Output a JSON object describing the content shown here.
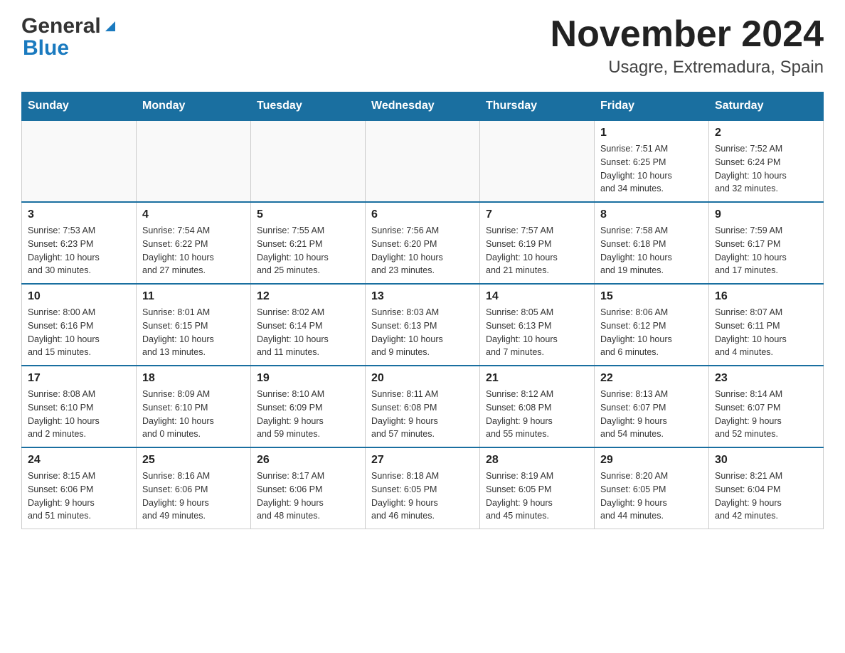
{
  "header": {
    "logo_general": "General",
    "logo_blue": "Blue",
    "title": "November 2024",
    "subtitle": "Usagre, Extremadura, Spain"
  },
  "weekdays": [
    "Sunday",
    "Monday",
    "Tuesday",
    "Wednesday",
    "Thursday",
    "Friday",
    "Saturday"
  ],
  "weeks": [
    [
      {
        "day": "",
        "info": ""
      },
      {
        "day": "",
        "info": ""
      },
      {
        "day": "",
        "info": ""
      },
      {
        "day": "",
        "info": ""
      },
      {
        "day": "",
        "info": ""
      },
      {
        "day": "1",
        "info": "Sunrise: 7:51 AM\nSunset: 6:25 PM\nDaylight: 10 hours\nand 34 minutes."
      },
      {
        "day": "2",
        "info": "Sunrise: 7:52 AM\nSunset: 6:24 PM\nDaylight: 10 hours\nand 32 minutes."
      }
    ],
    [
      {
        "day": "3",
        "info": "Sunrise: 7:53 AM\nSunset: 6:23 PM\nDaylight: 10 hours\nand 30 minutes."
      },
      {
        "day": "4",
        "info": "Sunrise: 7:54 AM\nSunset: 6:22 PM\nDaylight: 10 hours\nand 27 minutes."
      },
      {
        "day": "5",
        "info": "Sunrise: 7:55 AM\nSunset: 6:21 PM\nDaylight: 10 hours\nand 25 minutes."
      },
      {
        "day": "6",
        "info": "Sunrise: 7:56 AM\nSunset: 6:20 PM\nDaylight: 10 hours\nand 23 minutes."
      },
      {
        "day": "7",
        "info": "Sunrise: 7:57 AM\nSunset: 6:19 PM\nDaylight: 10 hours\nand 21 minutes."
      },
      {
        "day": "8",
        "info": "Sunrise: 7:58 AM\nSunset: 6:18 PM\nDaylight: 10 hours\nand 19 minutes."
      },
      {
        "day": "9",
        "info": "Sunrise: 7:59 AM\nSunset: 6:17 PM\nDaylight: 10 hours\nand 17 minutes."
      }
    ],
    [
      {
        "day": "10",
        "info": "Sunrise: 8:00 AM\nSunset: 6:16 PM\nDaylight: 10 hours\nand 15 minutes."
      },
      {
        "day": "11",
        "info": "Sunrise: 8:01 AM\nSunset: 6:15 PM\nDaylight: 10 hours\nand 13 minutes."
      },
      {
        "day": "12",
        "info": "Sunrise: 8:02 AM\nSunset: 6:14 PM\nDaylight: 10 hours\nand 11 minutes."
      },
      {
        "day": "13",
        "info": "Sunrise: 8:03 AM\nSunset: 6:13 PM\nDaylight: 10 hours\nand 9 minutes."
      },
      {
        "day": "14",
        "info": "Sunrise: 8:05 AM\nSunset: 6:13 PM\nDaylight: 10 hours\nand 7 minutes."
      },
      {
        "day": "15",
        "info": "Sunrise: 8:06 AM\nSunset: 6:12 PM\nDaylight: 10 hours\nand 6 minutes."
      },
      {
        "day": "16",
        "info": "Sunrise: 8:07 AM\nSunset: 6:11 PM\nDaylight: 10 hours\nand 4 minutes."
      }
    ],
    [
      {
        "day": "17",
        "info": "Sunrise: 8:08 AM\nSunset: 6:10 PM\nDaylight: 10 hours\nand 2 minutes."
      },
      {
        "day": "18",
        "info": "Sunrise: 8:09 AM\nSunset: 6:10 PM\nDaylight: 10 hours\nand 0 minutes."
      },
      {
        "day": "19",
        "info": "Sunrise: 8:10 AM\nSunset: 6:09 PM\nDaylight: 9 hours\nand 59 minutes."
      },
      {
        "day": "20",
        "info": "Sunrise: 8:11 AM\nSunset: 6:08 PM\nDaylight: 9 hours\nand 57 minutes."
      },
      {
        "day": "21",
        "info": "Sunrise: 8:12 AM\nSunset: 6:08 PM\nDaylight: 9 hours\nand 55 minutes."
      },
      {
        "day": "22",
        "info": "Sunrise: 8:13 AM\nSunset: 6:07 PM\nDaylight: 9 hours\nand 54 minutes."
      },
      {
        "day": "23",
        "info": "Sunrise: 8:14 AM\nSunset: 6:07 PM\nDaylight: 9 hours\nand 52 minutes."
      }
    ],
    [
      {
        "day": "24",
        "info": "Sunrise: 8:15 AM\nSunset: 6:06 PM\nDaylight: 9 hours\nand 51 minutes."
      },
      {
        "day": "25",
        "info": "Sunrise: 8:16 AM\nSunset: 6:06 PM\nDaylight: 9 hours\nand 49 minutes."
      },
      {
        "day": "26",
        "info": "Sunrise: 8:17 AM\nSunset: 6:06 PM\nDaylight: 9 hours\nand 48 minutes."
      },
      {
        "day": "27",
        "info": "Sunrise: 8:18 AM\nSunset: 6:05 PM\nDaylight: 9 hours\nand 46 minutes."
      },
      {
        "day": "28",
        "info": "Sunrise: 8:19 AM\nSunset: 6:05 PM\nDaylight: 9 hours\nand 45 minutes."
      },
      {
        "day": "29",
        "info": "Sunrise: 8:20 AM\nSunset: 6:05 PM\nDaylight: 9 hours\nand 44 minutes."
      },
      {
        "day": "30",
        "info": "Sunrise: 8:21 AM\nSunset: 6:04 PM\nDaylight: 9 hours\nand 42 minutes."
      }
    ]
  ]
}
